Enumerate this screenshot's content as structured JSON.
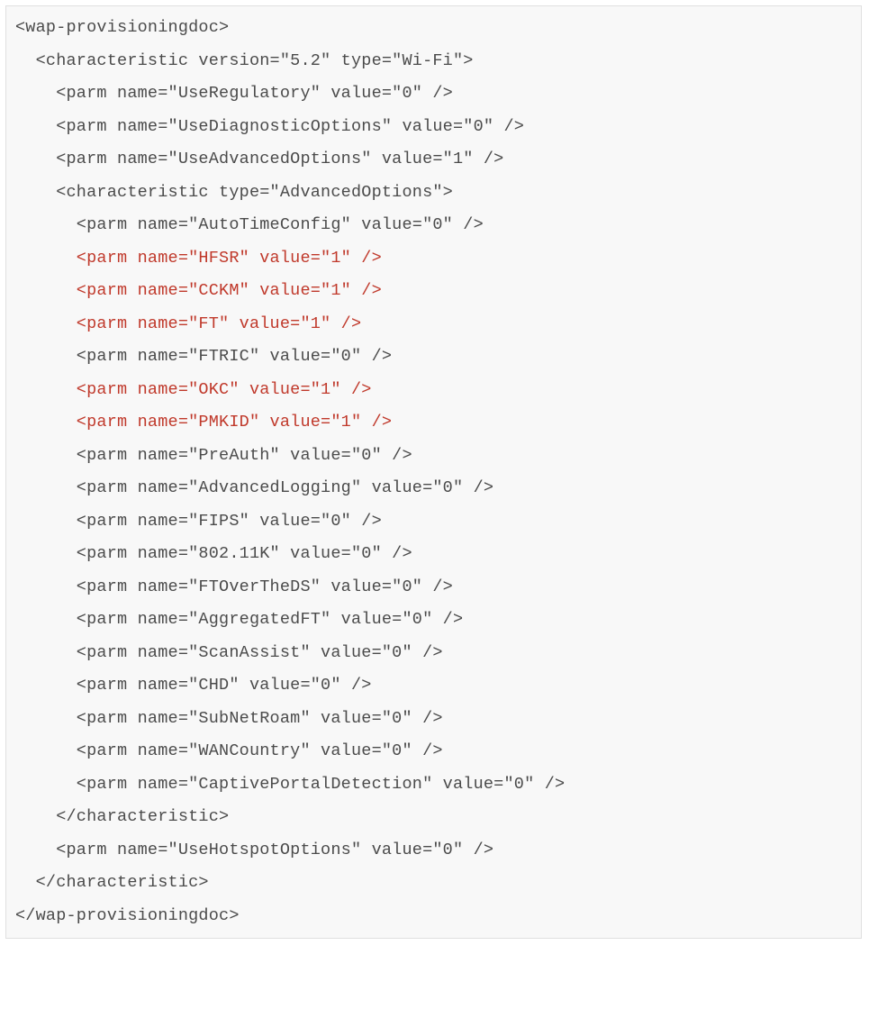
{
  "code": {
    "root_open": "<wap-provisioningdoc>",
    "root_close": "</wap-provisioningdoc>",
    "char_open": "  <characteristic version=\"5.2\" type=\"Wi-Fi\">",
    "char_close": "  </characteristic>",
    "inner_char_open": "    <characteristic type=\"AdvancedOptions\">",
    "inner_char_close": "    </characteristic>",
    "outer_parms": {
      "UseRegulatory": "    <parm name=\"UseRegulatory\" value=\"0\" />",
      "UseDiagnosticOptions": "    <parm name=\"UseDiagnosticOptions\" value=\"0\" />",
      "UseAdvancedOptions": "    <parm name=\"UseAdvancedOptions\" value=\"1\" />",
      "UseHotspotOptions": "    <parm name=\"UseHotspotOptions\" value=\"0\" />"
    },
    "advanced_parms": [
      {
        "text": "      <parm name=\"AutoTimeConfig\" value=\"0\" />",
        "highlight": false
      },
      {
        "text": "      <parm name=\"HFSR\" value=\"1\" />",
        "highlight": true
      },
      {
        "text": "      <parm name=\"CCKM\" value=\"1\" />",
        "highlight": true
      },
      {
        "text": "      <parm name=\"FT\" value=\"1\" />",
        "highlight": true
      },
      {
        "text": "      <parm name=\"FTRIC\" value=\"0\" />",
        "highlight": false
      },
      {
        "text": "      <parm name=\"OKC\" value=\"1\" />",
        "highlight": true
      },
      {
        "text": "      <parm name=\"PMKID\" value=\"1\" />",
        "highlight": true
      },
      {
        "text": "      <parm name=\"PreAuth\" value=\"0\" />",
        "highlight": false
      },
      {
        "text": "      <parm name=\"AdvancedLogging\" value=\"0\" />",
        "highlight": false
      },
      {
        "text": "      <parm name=\"FIPS\" value=\"0\" />",
        "highlight": false
      },
      {
        "text": "      <parm name=\"802.11K\" value=\"0\" />",
        "highlight": false
      },
      {
        "text": "      <parm name=\"FTOverTheDS\" value=\"0\" />",
        "highlight": false
      },
      {
        "text": "      <parm name=\"AggregatedFT\" value=\"0\" />",
        "highlight": false
      },
      {
        "text": "      <parm name=\"ScanAssist\" value=\"0\" />",
        "highlight": false
      },
      {
        "text": "      <parm name=\"CHD\" value=\"0\" />",
        "highlight": false
      },
      {
        "text": "      <parm name=\"SubNetRoam\" value=\"0\" />",
        "highlight": false
      },
      {
        "text": "      <parm name=\"WANCountry\" value=\"0\" />",
        "highlight": false
      },
      {
        "text": "      <parm name=\"CaptivePortalDetection\" value=\"0\" />",
        "highlight": false
      }
    ]
  }
}
